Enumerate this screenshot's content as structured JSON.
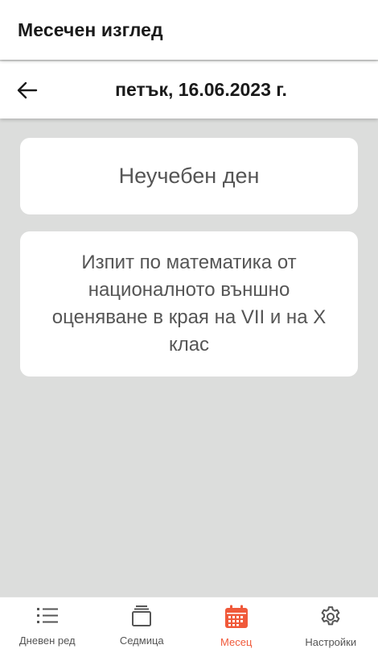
{
  "app": {
    "title": "Месечен изглед"
  },
  "date_bar": {
    "date_label": "петък, 16.06.2023 г.",
    "back_icon": "arrow-left-icon"
  },
  "cards": [
    {
      "text": "Неучебен ден"
    },
    {
      "text": "Изпит по математика от националното външно оценяване в края на VII и на X клас"
    }
  ],
  "bottom_nav": {
    "items": [
      {
        "label": "Дневен ред",
        "icon": "list-icon",
        "active": false
      },
      {
        "label": "Седмица",
        "icon": "stack-icon",
        "active": false
      },
      {
        "label": "Месец",
        "icon": "calendar-icon",
        "active": true
      },
      {
        "label": "Настройки",
        "icon": "gear-icon",
        "active": false
      }
    ]
  },
  "colors": {
    "accent": "#f0593a",
    "background": "#dcdddc",
    "text": "#555555"
  }
}
